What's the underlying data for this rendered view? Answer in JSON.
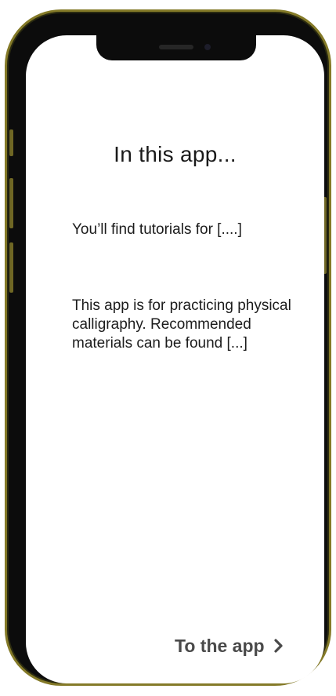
{
  "screen": {
    "title": "In this app...",
    "paragraphs": [
      "You’ll find tutorials for [....]",
      "This app is for practicing physical calligraphy. Recommended materials can be found [...]"
    ],
    "cta": {
      "label": "To the app",
      "icon": "chevron-right-icon"
    }
  },
  "colors": {
    "frame_gold": "#847a28",
    "bezel": "#0c0c0c",
    "text": "#1a1a1a",
    "cta_text": "#4a4a4a"
  }
}
